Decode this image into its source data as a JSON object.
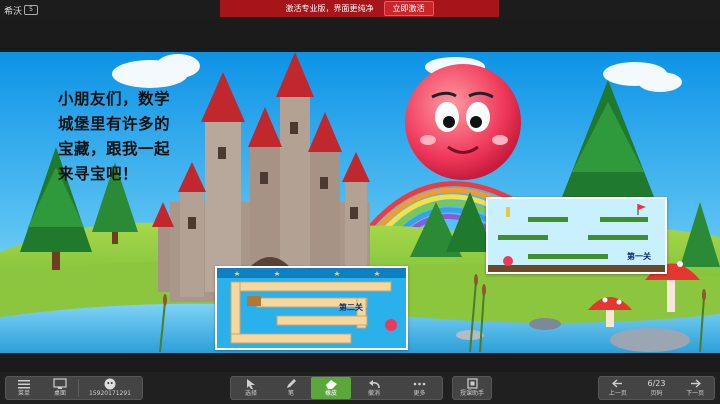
{
  "app": {
    "brand_name": "希沃",
    "brand_mark": "5"
  },
  "banner": {
    "message": "激活专业版，界面更纯净",
    "button_label": "立即激活"
  },
  "slide": {
    "speech_lines": [
      "小朋友们，数学",
      "城堡里有许多的",
      "宝藏，跟我一起",
      "来寻宝吧！"
    ],
    "card_left": {
      "level_label": "第二关"
    },
    "card_right": {
      "level_label": "第一关"
    }
  },
  "toolbar": {
    "left": [
      {
        "label": "菜单",
        "icon": "menu-icon"
      },
      {
        "label": "桌面",
        "icon": "desktop-icon"
      },
      {
        "label": "15920171291",
        "icon": "user-avatar-icon"
      }
    ],
    "tools": [
      {
        "label": "选择",
        "icon": "cursor-icon"
      },
      {
        "label": "笔",
        "icon": "pen-icon"
      },
      {
        "label": "橡皮",
        "icon": "eraser-icon",
        "active": true
      },
      {
        "label": "撤消",
        "icon": "undo-icon"
      },
      {
        "label": "更多",
        "icon": "more-icon"
      }
    ],
    "assistant": {
      "label": "授课助手",
      "icon": "assistant-icon"
    },
    "nav": {
      "prev_label": "上一页",
      "page_indicator": "6/23",
      "page_label": "页码",
      "next_label": "下一页"
    },
    "colors": {
      "bar": "#202020",
      "group": "#444444",
      "active": "#5aa83a"
    }
  }
}
